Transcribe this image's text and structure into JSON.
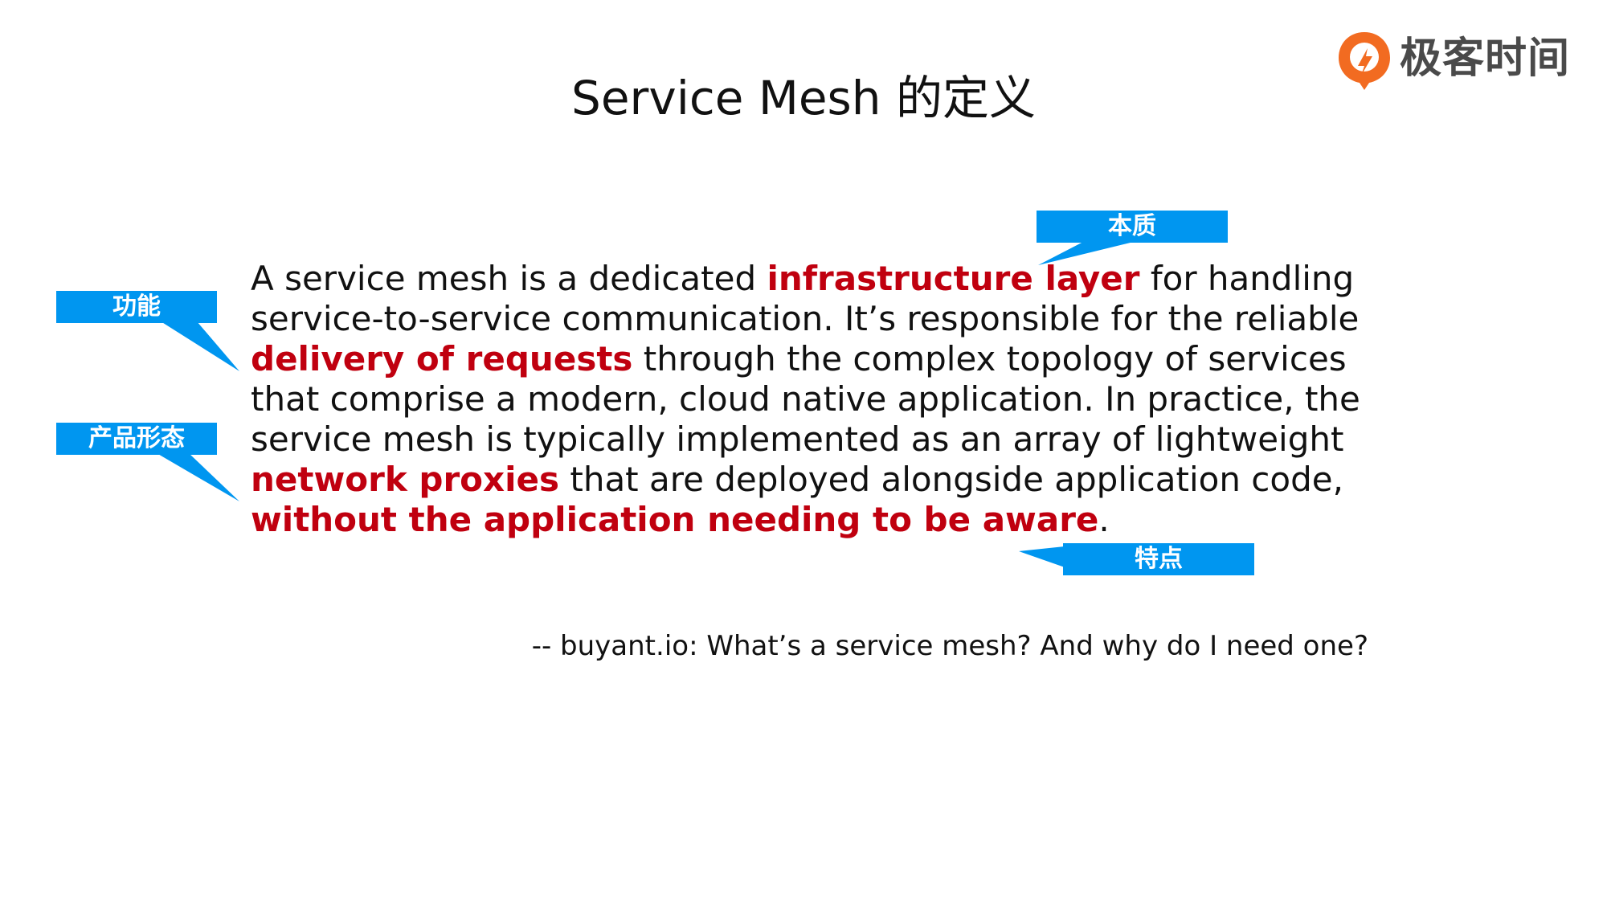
{
  "slide": {
    "title": "Service Mesh 的定义"
  },
  "brand": {
    "name": "极客时间",
    "accent_color": "#f26b21",
    "icon": "geektime-logo-icon"
  },
  "quote": {
    "segments": [
      {
        "text": "A service mesh is a dedicated ",
        "highlight": false
      },
      {
        "text": "infrastructure layer",
        "highlight": true
      },
      {
        "text": " for handling service-to-service communication. It’s responsible for the reliable ",
        "highlight": false
      },
      {
        "text": "delivery of requests",
        "highlight": true
      },
      {
        "text": " through the complex topology of services that comprise a modern, cloud native application. In practice, the service mesh is typically implemented as an array of lightweight ",
        "highlight": false
      },
      {
        "text": "network proxies",
        "highlight": true
      },
      {
        "text": " that are deployed alongside application code, ",
        "highlight": false
      },
      {
        "text": "without the application needing to be aware",
        "highlight": true
      },
      {
        "text": ".",
        "highlight": false
      }
    ],
    "source": "-- buyant.io: What’s a service mesh? And why do I need one?"
  },
  "callouts": {
    "essence": "本质",
    "function": "功能",
    "product_form": "产品形态",
    "feature": "特点",
    "fill_color": "#0096f0"
  },
  "colors": {
    "highlight": "#c0000f",
    "text": "#111111"
  }
}
